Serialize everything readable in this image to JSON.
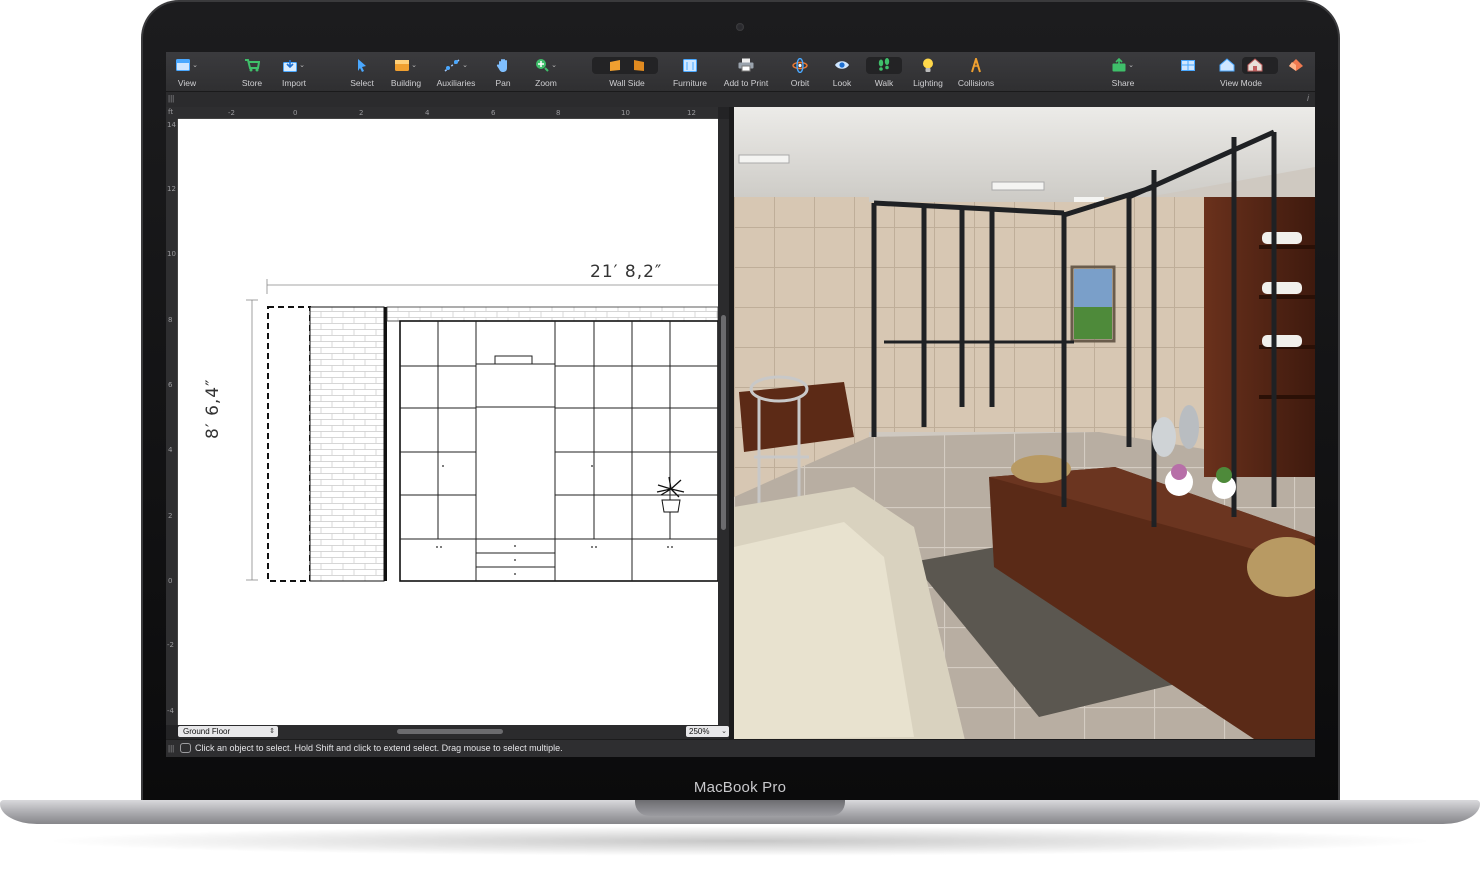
{
  "device": {
    "label": "MacBook Pro"
  },
  "toolbar": {
    "items": [
      {
        "label": "View",
        "icon": "view-icon",
        "caret": true
      },
      {
        "label": "Store",
        "icon": "store-cart-icon",
        "caret": false
      },
      {
        "label": "Import",
        "icon": "import-icon",
        "caret": true
      },
      {
        "label": "Select",
        "icon": "select-arrow-icon",
        "caret": false
      },
      {
        "label": "Building",
        "icon": "building-icon",
        "caret": true
      },
      {
        "label": "Auxiliaries",
        "icon": "auxiliaries-icon",
        "caret": true
      },
      {
        "label": "Pan",
        "icon": "pan-hand-icon",
        "caret": false
      },
      {
        "label": "Zoom",
        "icon": "zoom-icon",
        "caret": true
      },
      {
        "label": "Wall Side",
        "icon": "wall-side-icon",
        "caret": false
      },
      {
        "label": "Furniture",
        "icon": "furniture-icon",
        "caret": false
      },
      {
        "label": "Add to Print",
        "icon": "print-icon",
        "caret": false
      },
      {
        "label": "Orbit",
        "icon": "orbit-icon",
        "caret": false
      },
      {
        "label": "Look",
        "icon": "look-eye-icon",
        "caret": false
      },
      {
        "label": "Walk",
        "icon": "walk-footprints-icon",
        "caret": false
      },
      {
        "label": "Lighting",
        "icon": "lighting-bulb-icon",
        "caret": false
      },
      {
        "label": "Collisions",
        "icon": "collisions-icon",
        "caret": false
      },
      {
        "label": "Share",
        "icon": "share-icon",
        "caret": true
      },
      {
        "label": "View Mode",
        "icon": "view-mode-icon",
        "caret": false
      }
    ]
  },
  "ruler": {
    "top_ticks": [
      "-2",
      "0",
      "2",
      "4",
      "6",
      "8",
      "10",
      "12"
    ],
    "left_ticks": [
      "14",
      "12",
      "10",
      "8",
      "6",
      "4",
      "2",
      "0",
      "-2",
      "-4"
    ]
  },
  "plan": {
    "dimension_width": "21′ 8,2″",
    "dimension_height": "8′ 6,4″",
    "floor_selector": "Ground Floor",
    "zoom_level": "250%"
  },
  "status": {
    "message": "Click an object to select. Hold Shift and click to extend select. Drag mouse to select multiple."
  },
  "colors": {
    "accent_green": "#3fbf6a",
    "accent_orange": "#f0a030",
    "accent_blue": "#4aa8ff",
    "wood": "#5a2a18"
  }
}
